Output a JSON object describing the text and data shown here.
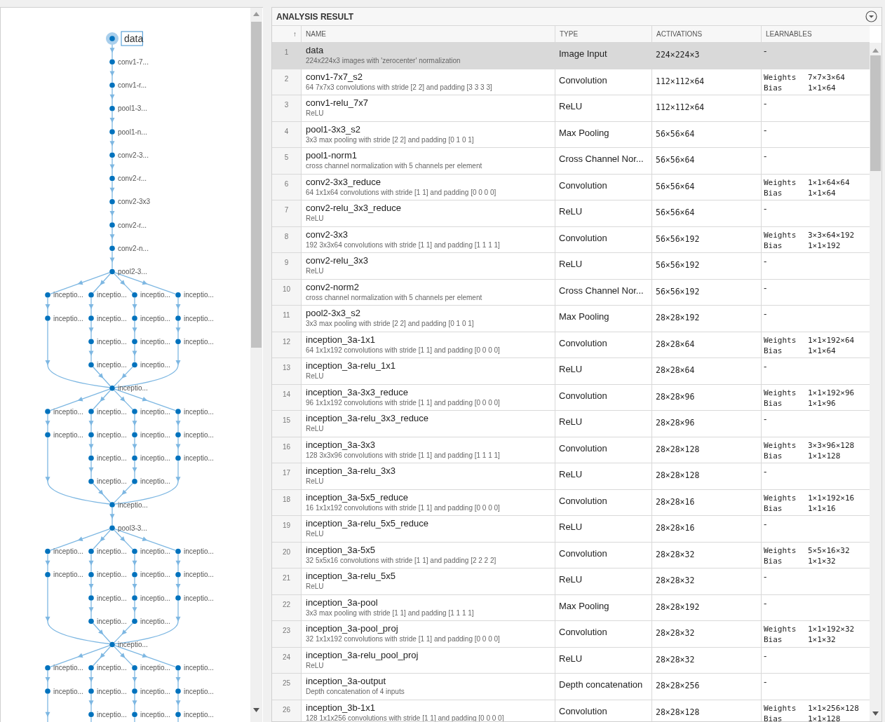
{
  "layer_graph": {
    "sections": [
      {
        "kind": "chain",
        "nodes": [
          {
            "label": "data",
            "selected": true
          },
          {
            "label": "conv1-7...",
            "selected": false
          },
          {
            "label": "conv1-r...",
            "selected": false
          },
          {
            "label": "pool1-3...",
            "selected": false
          },
          {
            "label": "pool1-n...",
            "selected": false
          },
          {
            "label": "conv2-3...",
            "selected": false
          },
          {
            "label": "conv2-r...",
            "selected": false
          },
          {
            "label": "conv2-3x3",
            "selected": false
          },
          {
            "label": "conv2-r...",
            "selected": false
          },
          {
            "label": "conv2-n...",
            "selected": false
          },
          {
            "label": "pool2-3...",
            "selected": false
          }
        ]
      },
      {
        "kind": "inception",
        "branches": [
          [
            {
              "label": "inceptio...",
              "selected": false
            },
            {
              "label": "inceptio...",
              "selected": false
            }
          ],
          [
            {
              "label": "inceptio...",
              "selected": false
            },
            {
              "label": "inceptio...",
              "selected": false
            },
            {
              "label": "inceptio...",
              "selected": false
            },
            {
              "label": "inceptio...",
              "selected": false
            }
          ],
          [
            {
              "label": "inceptio...",
              "selected": false
            },
            {
              "label": "inceptio...",
              "selected": false
            },
            {
              "label": "inceptio...",
              "selected": false
            },
            {
              "label": "inceptio...",
              "selected": false
            }
          ],
          [
            {
              "label": "inceptio...",
              "selected": false
            },
            {
              "label": "inceptio...",
              "selected": false
            },
            {
              "label": "inceptio...",
              "selected": false
            }
          ]
        ],
        "output": {
          "label": "inceptio...",
          "selected": false
        }
      },
      {
        "kind": "inception",
        "branches": [
          [
            {
              "label": "inceptio...",
              "selected": false
            },
            {
              "label": "inceptio...",
              "selected": false
            }
          ],
          [
            {
              "label": "inceptio...",
              "selected": false
            },
            {
              "label": "inceptio...",
              "selected": false
            },
            {
              "label": "inceptio...",
              "selected": false
            },
            {
              "label": "inceptio...",
              "selected": false
            }
          ],
          [
            {
              "label": "inceptio...",
              "selected": false
            },
            {
              "label": "inceptio...",
              "selected": false
            },
            {
              "label": "inceptio...",
              "selected": false
            },
            {
              "label": "inceptio...",
              "selected": false
            }
          ],
          [
            {
              "label": "inceptio...",
              "selected": false
            },
            {
              "label": "inceptio...",
              "selected": false
            },
            {
              "label": "inceptio...",
              "selected": false
            }
          ]
        ],
        "output": {
          "label": "inceptio...",
          "selected": false
        }
      },
      {
        "kind": "chain",
        "nodes": [
          {
            "label": "pool3-3...",
            "selected": false
          }
        ]
      },
      {
        "kind": "inception",
        "branches": [
          [
            {
              "label": "inceptio...",
              "selected": false
            },
            {
              "label": "inceptio...",
              "selected": false
            }
          ],
          [
            {
              "label": "inceptio...",
              "selected": false
            },
            {
              "label": "inceptio...",
              "selected": false
            },
            {
              "label": "inceptio...",
              "selected": false
            },
            {
              "label": "inceptio...",
              "selected": false
            }
          ],
          [
            {
              "label": "inceptio...",
              "selected": false
            },
            {
              "label": "inceptio...",
              "selected": false
            },
            {
              "label": "inceptio...",
              "selected": false
            },
            {
              "label": "inceptio...",
              "selected": false
            }
          ],
          [
            {
              "label": "inceptio...",
              "selected": false
            },
            {
              "label": "inceptio...",
              "selected": false
            },
            {
              "label": "inceptio...",
              "selected": false
            }
          ]
        ],
        "output": {
          "label": "inceptio...",
          "selected": false
        }
      },
      {
        "kind": "inception",
        "branches": [
          [
            {
              "label": "inceptio...",
              "selected": false
            },
            {
              "label": "inceptio...",
              "selected": false
            }
          ],
          [
            {
              "label": "inceptio...",
              "selected": false
            },
            {
              "label": "inceptio...",
              "selected": false
            },
            {
              "label": "inceptio...",
              "selected": false
            }
          ],
          [
            {
              "label": "inceptio...",
              "selected": false
            },
            {
              "label": "inceptio...",
              "selected": false
            },
            {
              "label": "inceptio...",
              "selected": false
            }
          ],
          [
            {
              "label": "inceptio...",
              "selected": false
            },
            {
              "label": "inceptio...",
              "selected": false
            },
            {
              "label": "inceptio...",
              "selected": false
            }
          ]
        ]
      }
    ]
  },
  "analysis_result": {
    "title": "ANALYSIS RESULT",
    "columns": [
      {
        "label": "↑"
      },
      {
        "label": "NAME"
      },
      {
        "label": "TYPE"
      },
      {
        "label": "ACTIVATIONS"
      },
      {
        "label": "LEARNABLES"
      }
    ],
    "rows": [
      {
        "index": "1",
        "name": "data",
        "description": "224x224x3 images with 'zerocenter' normalization",
        "type": "Image Input",
        "activations": "224×224×3",
        "learnables": "-",
        "selected": true
      },
      {
        "index": "2",
        "name": "conv1-7x7_s2",
        "description": "64 7x7x3 convolutions with stride [2 2] and padding [3 3 3 3]",
        "type": "Convolution",
        "activations": "112×112×64",
        "learnables": [
          {
            "label": "Weights",
            "value": "7×7×3×64"
          },
          {
            "label": "Bias",
            "value": "1×1×64"
          }
        ],
        "selected": false
      },
      {
        "index": "3",
        "name": "conv1-relu_7x7",
        "description": "ReLU",
        "type": "ReLU",
        "activations": "112×112×64",
        "learnables": "-",
        "selected": false
      },
      {
        "index": "4",
        "name": "pool1-3x3_s2",
        "description": "3x3 max pooling with stride [2 2] and padding [0 1 0 1]",
        "type": "Max Pooling",
        "activations": "56×56×64",
        "learnables": "-",
        "selected": false
      },
      {
        "index": "5",
        "name": "pool1-norm1",
        "description": "cross channel normalization with 5 channels per element",
        "type": "Cross Channel Nor...",
        "activations": "56×56×64",
        "learnables": "-",
        "selected": false
      },
      {
        "index": "6",
        "name": "conv2-3x3_reduce",
        "description": "64 1x1x64 convolutions with stride [1 1] and padding [0 0 0 0]",
        "type": "Convolution",
        "activations": "56×56×64",
        "learnables": [
          {
            "label": "Weights",
            "value": "1×1×64×64"
          },
          {
            "label": "Bias",
            "value": "1×1×64"
          }
        ],
        "selected": false
      },
      {
        "index": "7",
        "name": "conv2-relu_3x3_reduce",
        "description": "ReLU",
        "type": "ReLU",
        "activations": "56×56×64",
        "learnables": "-",
        "selected": false
      },
      {
        "index": "8",
        "name": "conv2-3x3",
        "description": "192 3x3x64 convolutions with stride [1 1] and padding [1 1 1 1]",
        "type": "Convolution",
        "activations": "56×56×192",
        "learnables": [
          {
            "label": "Weights",
            "value": "3×3×64×192"
          },
          {
            "label": "Bias",
            "value": "1×1×192"
          }
        ],
        "selected": false
      },
      {
        "index": "9",
        "name": "conv2-relu_3x3",
        "description": "ReLU",
        "type": "ReLU",
        "activations": "56×56×192",
        "learnables": "-",
        "selected": false
      },
      {
        "index": "10",
        "name": "conv2-norm2",
        "description": "cross channel normalization with 5 channels per element",
        "type": "Cross Channel Nor...",
        "activations": "56×56×192",
        "learnables": "-",
        "selected": false
      },
      {
        "index": "11",
        "name": "pool2-3x3_s2",
        "description": "3x3 max pooling with stride [2 2] and padding [0 1 0 1]",
        "type": "Max Pooling",
        "activations": "28×28×192",
        "learnables": "-",
        "selected": false
      },
      {
        "index": "12",
        "name": "inception_3a-1x1",
        "description": "64 1x1x192 convolutions with stride [1 1] and padding [0 0 0 0]",
        "type": "Convolution",
        "activations": "28×28×64",
        "learnables": [
          {
            "label": "Weights",
            "value": "1×1×192×64"
          },
          {
            "label": "Bias",
            "value": "1×1×64"
          }
        ],
        "selected": false
      },
      {
        "index": "13",
        "name": "inception_3a-relu_1x1",
        "description": "ReLU",
        "type": "ReLU",
        "activations": "28×28×64",
        "learnables": "-",
        "selected": false
      },
      {
        "index": "14",
        "name": "inception_3a-3x3_reduce",
        "description": "96 1x1x192 convolutions with stride [1 1] and padding [0 0 0 0]",
        "type": "Convolution",
        "activations": "28×28×96",
        "learnables": [
          {
            "label": "Weights",
            "value": "1×1×192×96"
          },
          {
            "label": "Bias",
            "value": "1×1×96"
          }
        ],
        "selected": false
      },
      {
        "index": "15",
        "name": "inception_3a-relu_3x3_reduce",
        "description": "ReLU",
        "type": "ReLU",
        "activations": "28×28×96",
        "learnables": "-",
        "selected": false
      },
      {
        "index": "16",
        "name": "inception_3a-3x3",
        "description": "128 3x3x96 convolutions with stride [1 1] and padding [1 1 1 1]",
        "type": "Convolution",
        "activations": "28×28×128",
        "learnables": [
          {
            "label": "Weights",
            "value": "3×3×96×128"
          },
          {
            "label": "Bias",
            "value": "1×1×128"
          }
        ],
        "selected": false
      },
      {
        "index": "17",
        "name": "inception_3a-relu_3x3",
        "description": "ReLU",
        "type": "ReLU",
        "activations": "28×28×128",
        "learnables": "-",
        "selected": false
      },
      {
        "index": "18",
        "name": "inception_3a-5x5_reduce",
        "description": "16 1x1x192 convolutions with stride [1 1] and padding [0 0 0 0]",
        "type": "Convolution",
        "activations": "28×28×16",
        "learnables": [
          {
            "label": "Weights",
            "value": "1×1×192×16"
          },
          {
            "label": "Bias",
            "value": "1×1×16"
          }
        ],
        "selected": false
      },
      {
        "index": "19",
        "name": "inception_3a-relu_5x5_reduce",
        "description": "ReLU",
        "type": "ReLU",
        "activations": "28×28×16",
        "learnables": "-",
        "selected": false
      },
      {
        "index": "20",
        "name": "inception_3a-5x5",
        "description": "32 5x5x16 convolutions with stride [1 1] and padding [2 2 2 2]",
        "type": "Convolution",
        "activations": "28×28×32",
        "learnables": [
          {
            "label": "Weights",
            "value": "5×5×16×32"
          },
          {
            "label": "Bias",
            "value": "1×1×32"
          }
        ],
        "selected": false
      },
      {
        "index": "21",
        "name": "inception_3a-relu_5x5",
        "description": "ReLU",
        "type": "ReLU",
        "activations": "28×28×32",
        "learnables": "-",
        "selected": false
      },
      {
        "index": "22",
        "name": "inception_3a-pool",
        "description": "3x3 max pooling with stride [1 1] and padding [1 1 1 1]",
        "type": "Max Pooling",
        "activations": "28×28×192",
        "learnables": "-",
        "selected": false
      },
      {
        "index": "23",
        "name": "inception_3a-pool_proj",
        "description": "32 1x1x192 convolutions with stride [1 1] and padding [0 0 0 0]",
        "type": "Convolution",
        "activations": "28×28×32",
        "learnables": [
          {
            "label": "Weights",
            "value": "1×1×192×32"
          },
          {
            "label": "Bias",
            "value": "1×1×32"
          }
        ],
        "selected": false
      },
      {
        "index": "24",
        "name": "inception_3a-relu_pool_proj",
        "description": "ReLU",
        "type": "ReLU",
        "activations": "28×28×32",
        "learnables": "-",
        "selected": false
      },
      {
        "index": "25",
        "name": "inception_3a-output",
        "description": "Depth concatenation of 4 inputs",
        "type": "Depth concatenation",
        "activations": "28×28×256",
        "learnables": "-",
        "selected": false
      },
      {
        "index": "26",
        "name": "inception_3b-1x1",
        "description": "128 1x1x256 convolutions with stride [1 1] and padding [0 0 0 0]",
        "type": "Convolution",
        "activations": "28×28×128",
        "learnables": [
          {
            "label": "Weights",
            "value": "1×1×256×128"
          },
          {
            "label": "Bias",
            "value": "1×1×128"
          }
        ],
        "selected": false
      }
    ]
  }
}
